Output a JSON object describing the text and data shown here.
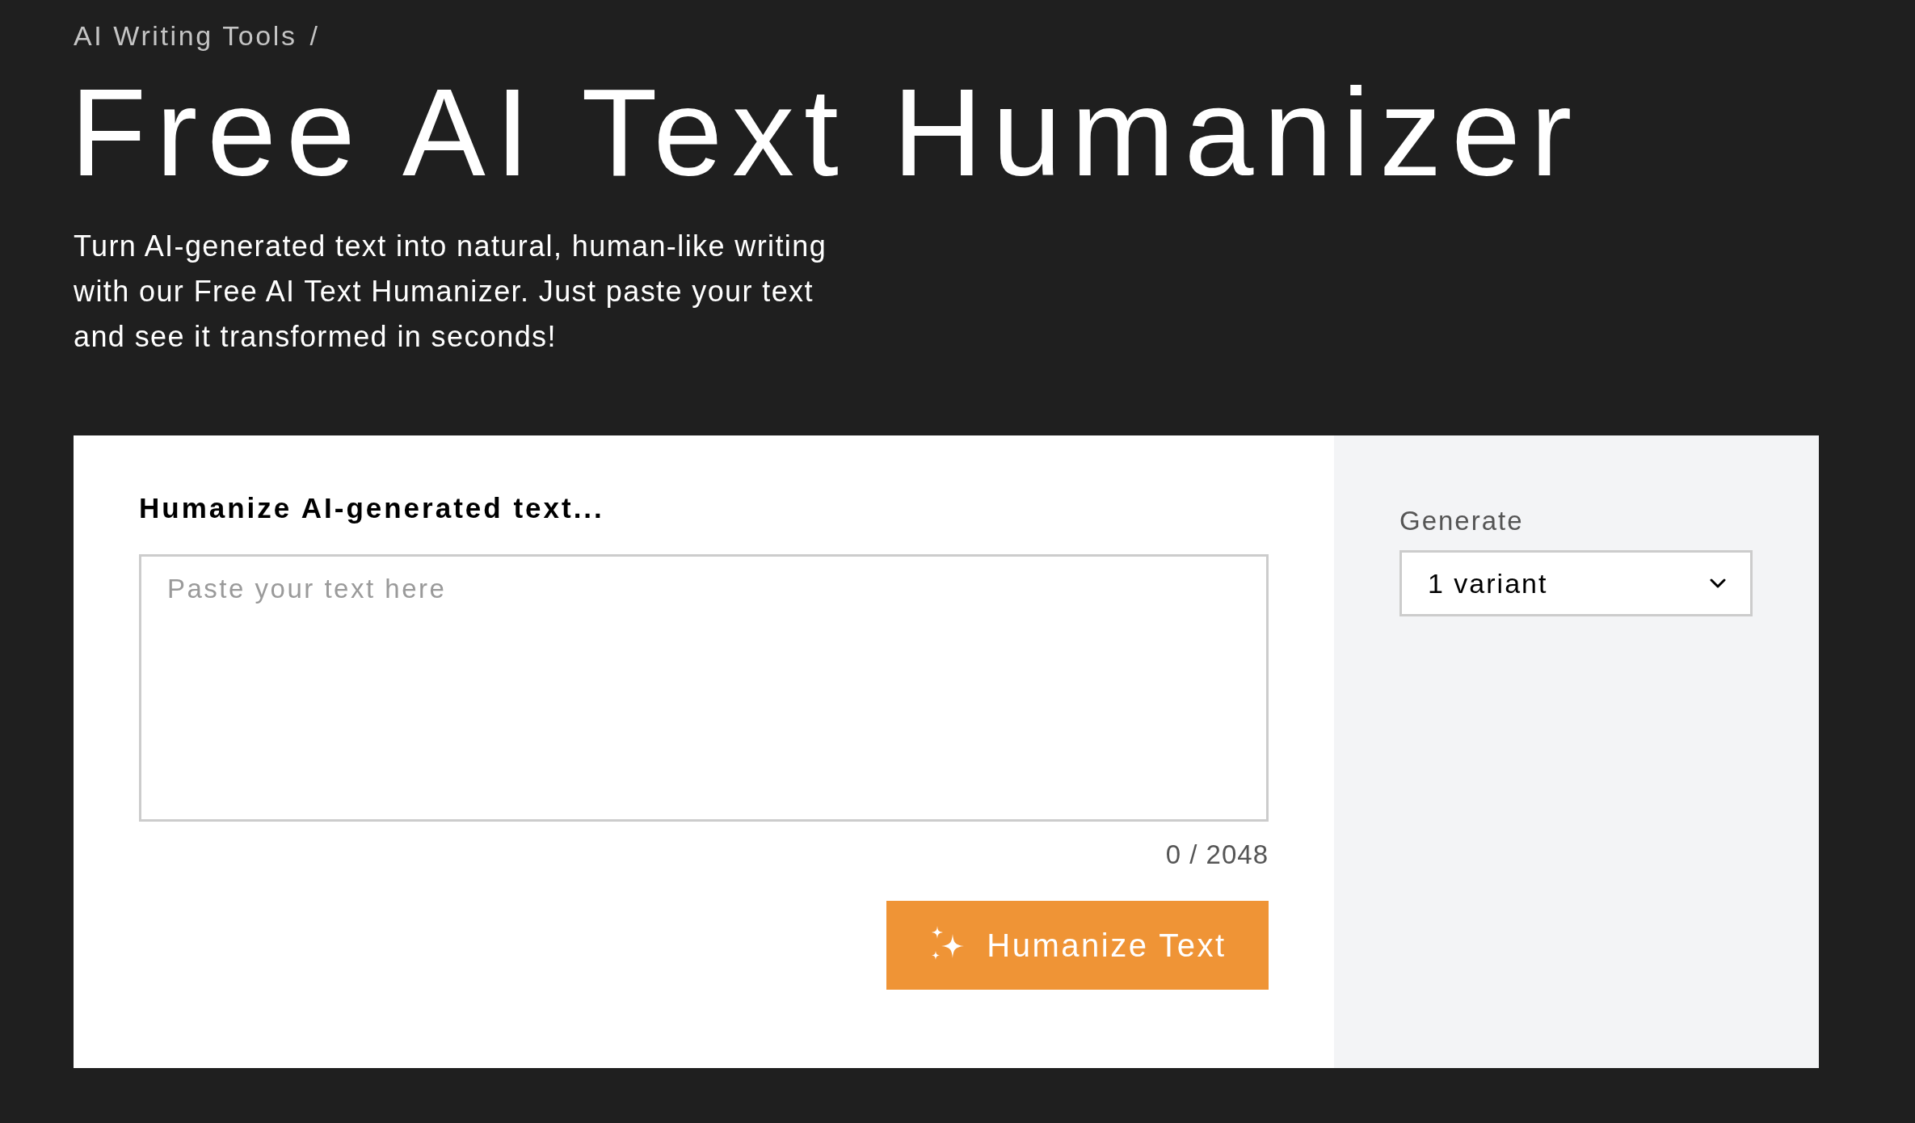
{
  "breadcrumb": {
    "items": [
      {
        "label": "AI Writing Tools"
      }
    ],
    "separator": "/"
  },
  "title": "Free AI Text Humanizer",
  "intro": "Turn AI-generated text into natural, human-like writing with our Free AI Text Humanizer. Just paste your text and see it transformed in seconds!",
  "editor": {
    "heading": "Humanize AI-generated text...",
    "input": {
      "placeholder": "Paste your text here"
    },
    "counter": "0 / 2048",
    "submit_button": {
      "label": "Humanize Text"
    }
  },
  "options": {
    "generate": {
      "label": "Generate",
      "value": "1 variant"
    }
  }
}
